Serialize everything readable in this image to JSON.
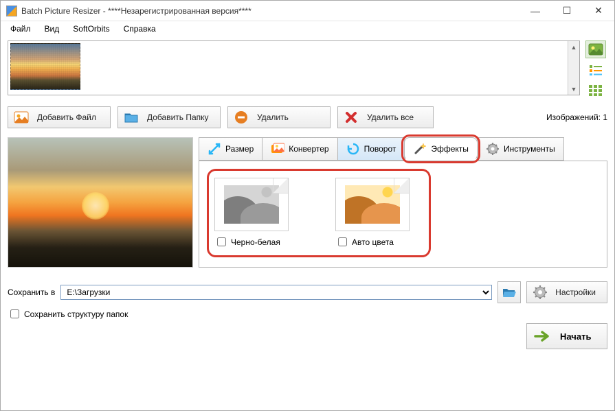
{
  "window": {
    "title": "Batch Picture Resizer - ****Незарегистрированная версия****"
  },
  "menu": {
    "file": "Файл",
    "view": "Вид",
    "softorbits": "SoftOrbits",
    "help": "Справка"
  },
  "toolbar": {
    "add_file": "Добавить Файл",
    "add_folder": "Добавить Папку",
    "delete": "Удалить",
    "delete_all": "Удалить все",
    "image_count_label": "Изображений: 1"
  },
  "tabs": {
    "size": "Размер",
    "converter": "Конвертер",
    "rotate": "Поворот",
    "effects": "Эффекты",
    "tools": "Инструменты"
  },
  "effects": {
    "grayscale": "Черно-белая",
    "autocolor": "Авто цвета"
  },
  "save": {
    "label": "Сохранить в",
    "path": "E:\\Загрузки",
    "keep_structure": "Сохранить структуру папок",
    "settings": "Настройки",
    "start": "Начать"
  },
  "icons": {
    "minimize": "—",
    "maximize": "☐",
    "close": "✕",
    "scroll_up": "▲",
    "scroll_down": "▼"
  }
}
